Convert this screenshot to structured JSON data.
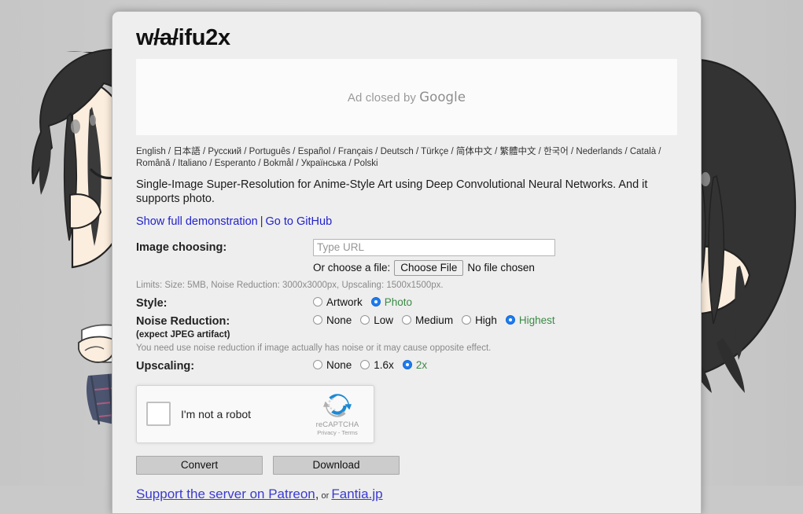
{
  "site": {
    "title_before": "w",
    "title_struck": "/a/",
    "title_after": "ifu2x"
  },
  "ad": {
    "text_prefix": "Ad closed by ",
    "brand": "Google"
  },
  "languages": [
    "English",
    "日本語",
    "Русский",
    "Português",
    "Español",
    "Français",
    "Deutsch",
    "Türkçe",
    "简体中文",
    "繁體中文",
    "한국어",
    "Nederlands",
    "Català",
    "Română",
    "Italiano",
    "Esperanto",
    "Bokmål",
    "Українська",
    "Polski"
  ],
  "description": "Single-Image Super-Resolution for Anime-Style Art using Deep Convolutional Neural Networks. And it supports photo.",
  "links": {
    "demo": "Show full demonstration",
    "separator": "|",
    "github": "Go to GitHub"
  },
  "image_choosing": {
    "label": "Image choosing:",
    "url_placeholder": "Type URL",
    "url_value": "",
    "or_choose_file": "Or choose a file:",
    "choose_file_button": "Choose File",
    "no_file_text": "No file chosen",
    "limits": "Limits: Size: 5MB, Noise Reduction: 3000x3000px, Upscaling: 1500x1500px."
  },
  "style": {
    "label": "Style:",
    "options": [
      {
        "label": "Artwork",
        "selected": false
      },
      {
        "label": "Photo",
        "selected": true
      }
    ]
  },
  "noise_reduction": {
    "label": "Noise Reduction:",
    "sub_label": "(expect JPEG artifact)",
    "options": [
      {
        "label": "None",
        "selected": false
      },
      {
        "label": "Low",
        "selected": false
      },
      {
        "label": "Medium",
        "selected": false
      },
      {
        "label": "High",
        "selected": false
      },
      {
        "label": "Highest",
        "selected": true
      }
    ],
    "hint": "You need use noise reduction if image actually has noise or it may cause opposite effect."
  },
  "upscaling": {
    "label": "Upscaling:",
    "options": [
      {
        "label": "None",
        "selected": false
      },
      {
        "label": "1.6x",
        "selected": false
      },
      {
        "label": "2x",
        "selected": true
      }
    ]
  },
  "recaptcha": {
    "checkbox_label": "I'm not a robot",
    "brand_name": "reCAPTCHA",
    "legal": "Privacy - Terms",
    "checked": false
  },
  "actions": {
    "convert": "Convert",
    "download": "Download"
  },
  "support": {
    "patreon": "Support the server on Patreon",
    "comma": ",",
    "or": " or ",
    "fantia": "Fantia.jp"
  },
  "colors": {
    "background": "#c9c9c9",
    "panel": "#eeeeee",
    "link": "#2222cc",
    "selected_label": "#3b8a46",
    "radio_selected": "#1d7cf2",
    "hint_text": "#8a8a8a",
    "hair": "#333333",
    "skin": "#fceede"
  }
}
